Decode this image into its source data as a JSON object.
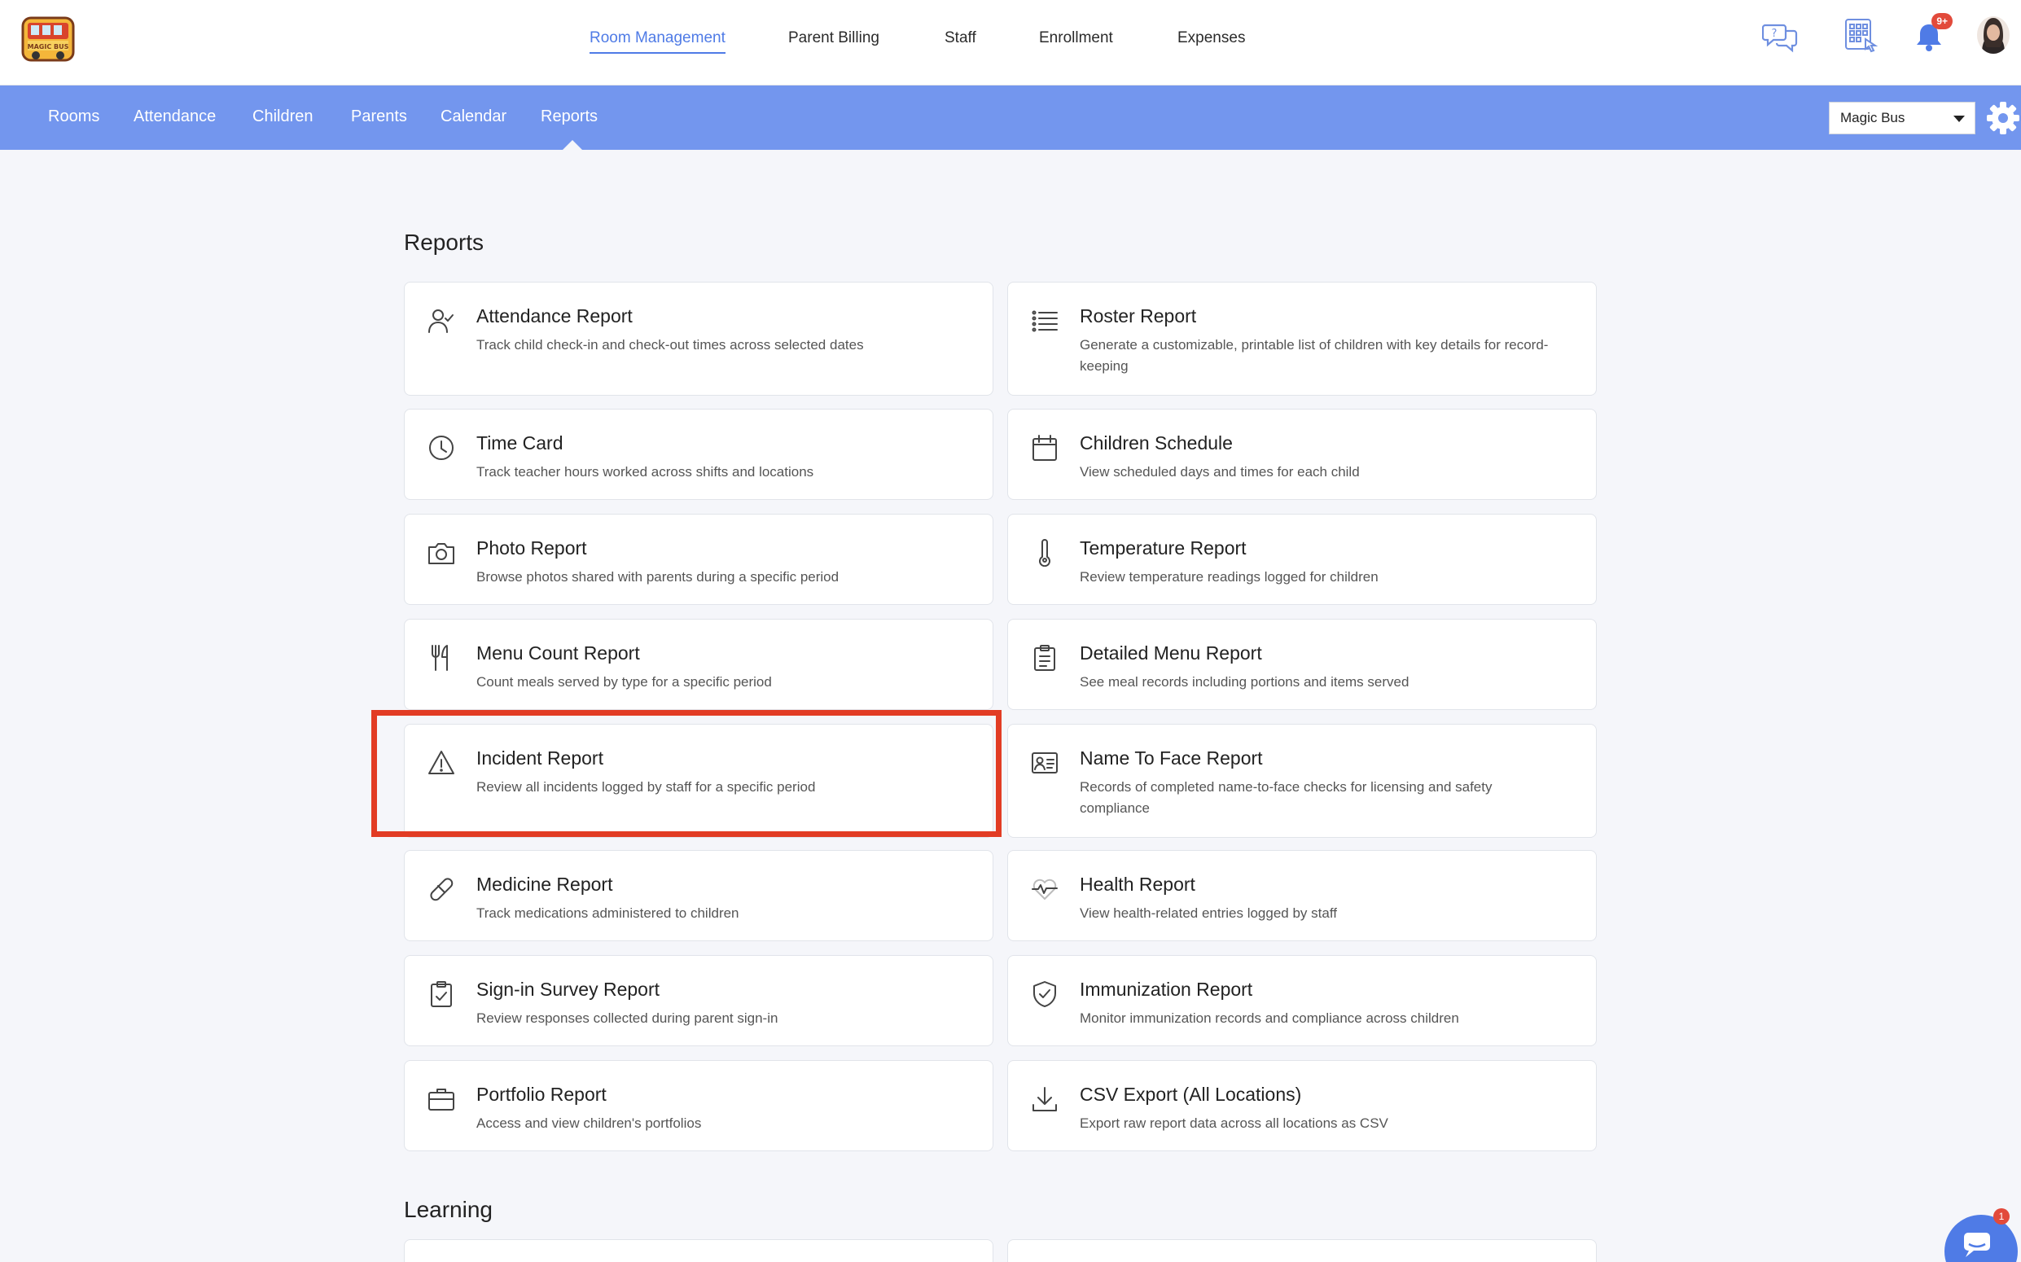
{
  "header": {
    "logo_text": "MAGIC BUS",
    "nav": [
      {
        "label": "Room Management",
        "active": true
      },
      {
        "label": "Parent Billing"
      },
      {
        "label": "Staff"
      },
      {
        "label": "Enrollment"
      },
      {
        "label": "Expenses"
      }
    ],
    "icons": [
      "help-chat-icon",
      "kiosk-keypad-icon",
      "bell-icon"
    ],
    "notification_badge": "9+"
  },
  "subnav": {
    "items": [
      {
        "label": "Rooms"
      },
      {
        "label": "Attendance"
      },
      {
        "label": "Children"
      },
      {
        "label": "Parents"
      },
      {
        "label": "Calendar"
      },
      {
        "label": "Reports",
        "active": true
      }
    ],
    "location_select": {
      "value": "Magic Bus"
    }
  },
  "reports": {
    "title": "Reports",
    "cards": [
      {
        "title": "Attendance Report",
        "desc": "Track child check-in and check-out times across selected dates",
        "icon": "user-check-icon"
      },
      {
        "title": "Roster Report",
        "desc": "Generate a customizable, printable list of children with key details for record-keeping",
        "icon": "list-icon"
      },
      {
        "title": "Time Card",
        "desc": "Track teacher hours worked across shifts and locations",
        "icon": "clock-icon"
      },
      {
        "title": "Children Schedule",
        "desc": "View scheduled days and times for each child",
        "icon": "calendar-icon"
      },
      {
        "title": "Photo Report",
        "desc": "Browse photos shared with parents during a specific period",
        "icon": "camera-icon"
      },
      {
        "title": "Temperature Report",
        "desc": "Review temperature readings logged for children",
        "icon": "thermometer-icon"
      },
      {
        "title": "Menu Count Report",
        "desc": "Count meals served by type for a specific period",
        "icon": "utensils-icon"
      },
      {
        "title": "Detailed Menu Report",
        "desc": "See meal records including portions and items served",
        "icon": "clipboard-list-icon"
      },
      {
        "title": "Incident Report",
        "desc": "Review all incidents logged by staff for a specific period",
        "icon": "warning-icon"
      },
      {
        "title": "Name To Face Report",
        "desc": "Records of completed name-to-face checks for licensing and safety compliance",
        "icon": "id-card-icon"
      },
      {
        "title": "Medicine Report",
        "desc": "Track medications administered to children",
        "icon": "pill-icon"
      },
      {
        "title": "Health Report",
        "desc": "View health-related entries logged by staff",
        "icon": "heartbeat-icon"
      },
      {
        "title": "Sign-in Survey Report",
        "desc": "Review responses collected during parent sign-in",
        "icon": "clipboard-check-icon"
      },
      {
        "title": "Immunization Report",
        "desc": "Monitor immunization records and compliance across children",
        "icon": "shield-check-icon"
      },
      {
        "title": "Portfolio Report",
        "desc": "Access and view children's portfolios",
        "icon": "briefcase-icon"
      },
      {
        "title": "CSV Export (All Locations)",
        "desc": "Export raw report data across all locations as CSV",
        "icon": "download-icon"
      }
    ]
  },
  "learning": {
    "title": "Learning"
  },
  "chat_widget": {
    "badge": "1"
  },
  "colors": {
    "accent": "#4f7be6",
    "subnav_bg": "#7396ee",
    "highlight": "#e23c24"
  }
}
